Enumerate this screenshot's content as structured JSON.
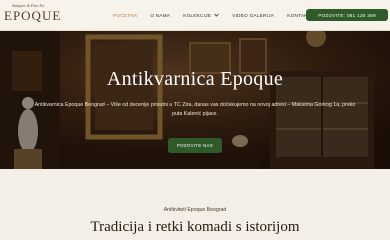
{
  "logo": {
    "tagline": "Antiques & Fine Art",
    "name": "EPOQUE"
  },
  "nav": {
    "items": [
      {
        "label": "POČETNA",
        "active": true
      },
      {
        "label": "O NAMA",
        "active": false
      },
      {
        "label": "KOLEKCIJE",
        "active": false,
        "has_dropdown": true
      },
      {
        "label": "VIDEO GALERIJA",
        "active": false
      },
      {
        "label": "KONTAKT",
        "active": false
      }
    ],
    "call_button": "POZOVITE: 061 130 369"
  },
  "hero": {
    "title": "Antikvarnica Epoque",
    "text": "Antikvarnica Epoque Beograd – Više od decenije prisutni u TC Zira, danas vas dočekujemo na novoj adresi – Maksima Gorkog 1a, preko puta Kalenić pijace.",
    "button": "POZOVITE NAS"
  },
  "section": {
    "eyebrow": "Antikviteti Epoque Beograd",
    "heading": "Tradicija i retki komadi s istorijom"
  },
  "colors": {
    "accent_green": "#2f5a2a",
    "active_nav": "#b07a3c",
    "page_bg": "#f4efe6"
  }
}
